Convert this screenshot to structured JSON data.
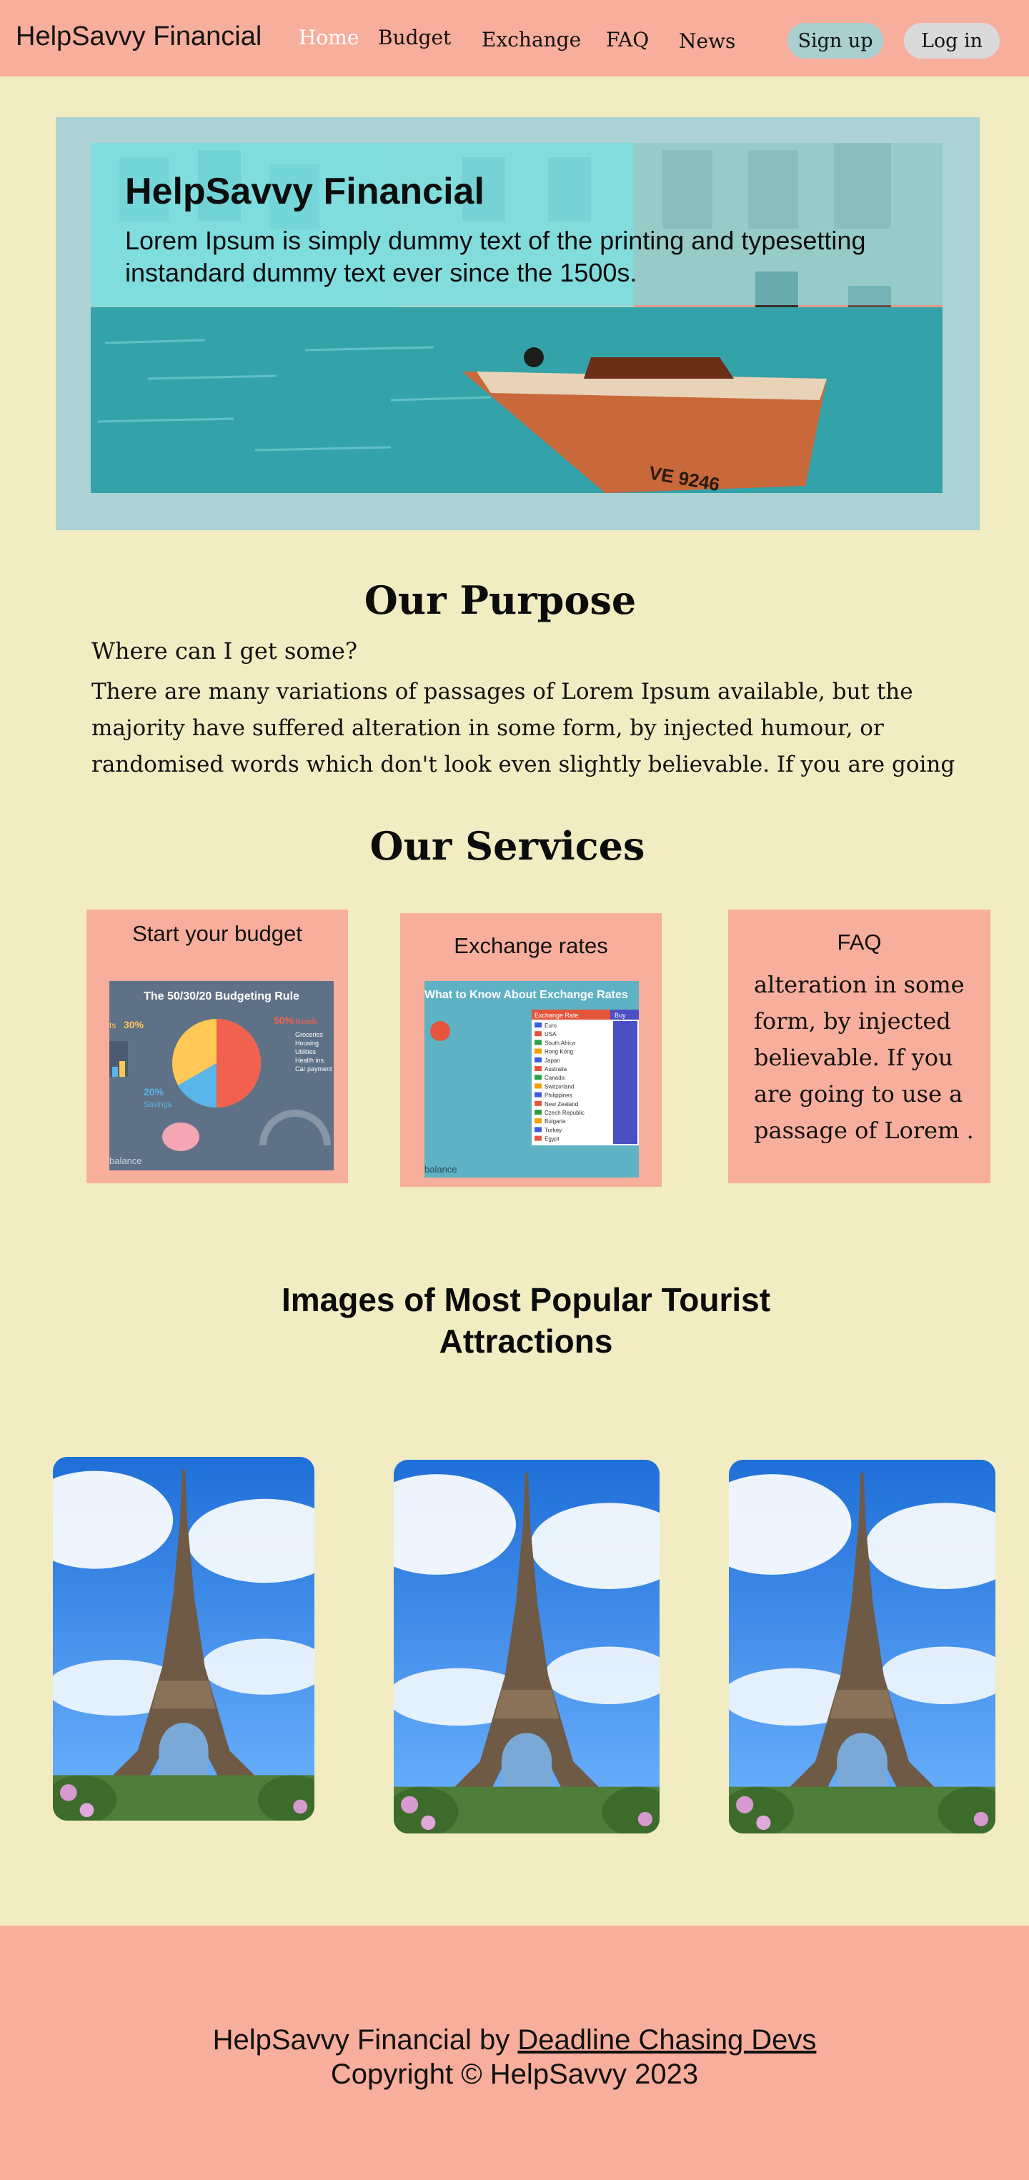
{
  "nav": {
    "brand": "HelpSavvy Financial",
    "links": [
      "Home",
      "Budget",
      "Exchange",
      "FAQ",
      "News"
    ],
    "active": "Home",
    "signup_label": "Sign up",
    "login_label": "Log in"
  },
  "hero": {
    "title": "HelpSavvy Financial",
    "text": "Lorem Ipsum is simply dummy text of the printing and typesetting instandard dummy text ever since the 1500s.",
    "boat_label": "VE 9246"
  },
  "purpose": {
    "heading": "Our Purpose",
    "subheading": "Where can I get some?",
    "body": "There are many variations of passages of Lorem Ipsum available, but the majority have suffered alteration in some form, by injected humour, or randomised words which don't look even slightly believable. If you are going to use a passage of Lorem"
  },
  "services": {
    "heading": "Our Services",
    "cards": [
      {
        "title": "Start your budget",
        "image": {
          "title": "The 50/30/20 Budgeting Rule",
          "pct_30": "30%",
          "pct_50": "50%",
          "pct_20": "20%",
          "label_needs": "Needs",
          "label_savings": "Savings",
          "needs_items": [
            "Groceries",
            "Housing",
            "Utilities",
            "Health ins.",
            "Car payment"
          ],
          "caption": "balance"
        }
      },
      {
        "title": "Exchange rates",
        "image": {
          "title": "What to Know About Exchange Rates",
          "col_rate": "Exchange Rate",
          "col_buy": "Buy",
          "currencies": [
            "Euro",
            "USA",
            "South Africa",
            "Hong Kong",
            "Japan",
            "Australia",
            "Canada",
            "Switzerland",
            "Philippines",
            "New Zealand",
            "Czech Republic",
            "Bulgaria",
            "Turkey",
            "Egypt"
          ],
          "caption": "balance"
        }
      },
      {
        "title": "FAQ",
        "body": "alteration in some form, by injected believable. If you are going to use a passage of Lorem ."
      }
    ]
  },
  "attractions": {
    "heading": "Images of Most Popular Tourist Attractions"
  },
  "footer": {
    "prefix": "HelpSavvy Financial by ",
    "link": "Deadline Chasing Devs",
    "copyright": "Copyright © HelpSavvy 2023"
  },
  "colors": {
    "background": "#f2ecc3",
    "salmon": "#f8ae9c",
    "teal": "#add2d3",
    "signup": "#a9cfcf",
    "login": "#dadada"
  }
}
